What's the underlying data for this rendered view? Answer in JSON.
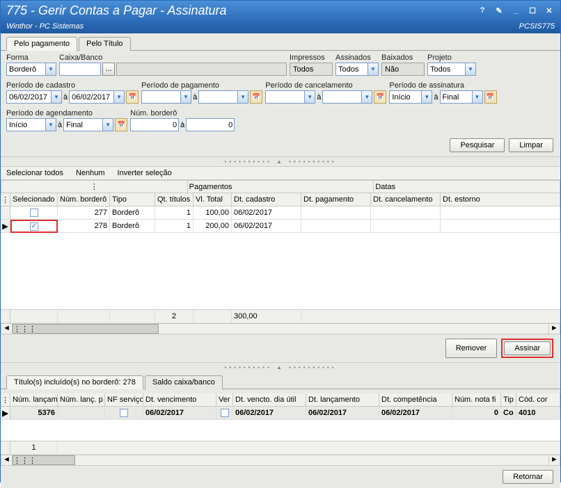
{
  "window": {
    "title": "775 - Gerir Contas a Pagar - Assinatura",
    "subtitle": "Winthor - PC Sistemas",
    "code": "PCSIS775"
  },
  "tabs_upper": {
    "t1": "Pelo pagamento",
    "t2": "Pelo Título"
  },
  "filters": {
    "forma": {
      "label": "Forma",
      "value": "Borderô"
    },
    "caixa": {
      "label": "Caixa/Banco",
      "value": ""
    },
    "impressos": {
      "label": "Impressos",
      "value": "Todos"
    },
    "assinados": {
      "label": "Assinados",
      "value": "Todos"
    },
    "baixados": {
      "label": "Baixados",
      "value": "Não"
    },
    "projeto": {
      "label": "Projeto",
      "value": "Todos"
    },
    "per_cad": {
      "label": "Período de cadastro",
      "from": "06/02/2017",
      "sep": "à",
      "to": "06/02/2017"
    },
    "per_pag": {
      "label": "Período de pagamento",
      "from": "",
      "sep": "à",
      "to": ""
    },
    "per_can": {
      "label": "Período de cancelamento",
      "from": "",
      "sep": "à",
      "to": ""
    },
    "per_ass": {
      "label": "Período de assinatura",
      "from": "Início",
      "sep": "à",
      "to": "Final"
    },
    "per_age": {
      "label": "Período de agendamento",
      "from": "Início",
      "sep": "à",
      "to": "Final"
    },
    "num_bord": {
      "label": "Núm. borderô",
      "from": "0",
      "sep": "à",
      "to": "0"
    }
  },
  "buttons": {
    "pesquisar": "Pesquisar",
    "limpar": "Limpar",
    "remover": "Remover",
    "assinar": "Assinar",
    "retornar": "Retornar",
    "ellipsis": "..."
  },
  "sel_bar": {
    "todos": "Selecionar todos",
    "nenhum": "Nenhum",
    "inverter": "Inverter seleção"
  },
  "grid1": {
    "group_pag": "Pagamentos",
    "group_dat": "Datas",
    "cols": {
      "sel": "Selecionado",
      "nb": "Núm. borderô",
      "tipo": "Tipo",
      "qt": "Qt. títulos",
      "vl": "Vl. Total",
      "dc": "Dt. cadastro",
      "dp": "Dt. pagamento",
      "dcan": "Dt. cancelamento",
      "de": "Dt. estorno"
    },
    "rows": [
      {
        "sel": false,
        "nb": "277",
        "tipo": "Borderô",
        "qt": "1",
        "vl": "100,00",
        "dc": "06/02/2017",
        "dp": "",
        "dcan": "",
        "de": ""
      },
      {
        "sel": true,
        "nb": "278",
        "tipo": "Borderô",
        "qt": "1",
        "vl": "200,00",
        "dc": "06/02/2017",
        "dp": "",
        "dcan": "",
        "de": ""
      }
    ],
    "footer": {
      "qt": "2",
      "vl": "300,00"
    }
  },
  "tabs_lower": {
    "t1": "Título(s) incluído(s) no borderô: 278",
    "t2": "Saldo caixa/banco"
  },
  "grid2": {
    "cols": {
      "nl": "Núm. lançam",
      "nlp": "Núm. lanç. p",
      "nf": "NF serviço",
      "dv": "Dt. vencimento",
      "ver": "Ver",
      "dvu": "Dt. vencto. dia útil",
      "dl": "Dt. lançamento",
      "dcomp": "Dt. competência",
      "nnf": "Núm. nota fi",
      "tip": "Tip",
      "cod": "Cód. cor"
    },
    "rows": [
      {
        "nl": "5376",
        "nlp": "",
        "nf": false,
        "dv": "06/02/2017",
        "ver": false,
        "dvu": "06/02/2017",
        "dl": "06/02/2017",
        "dcomp": "06/02/2017",
        "nnf": "0",
        "tip": "Co",
        "cod": "4010"
      }
    ],
    "footer": {
      "nl": "1"
    }
  }
}
